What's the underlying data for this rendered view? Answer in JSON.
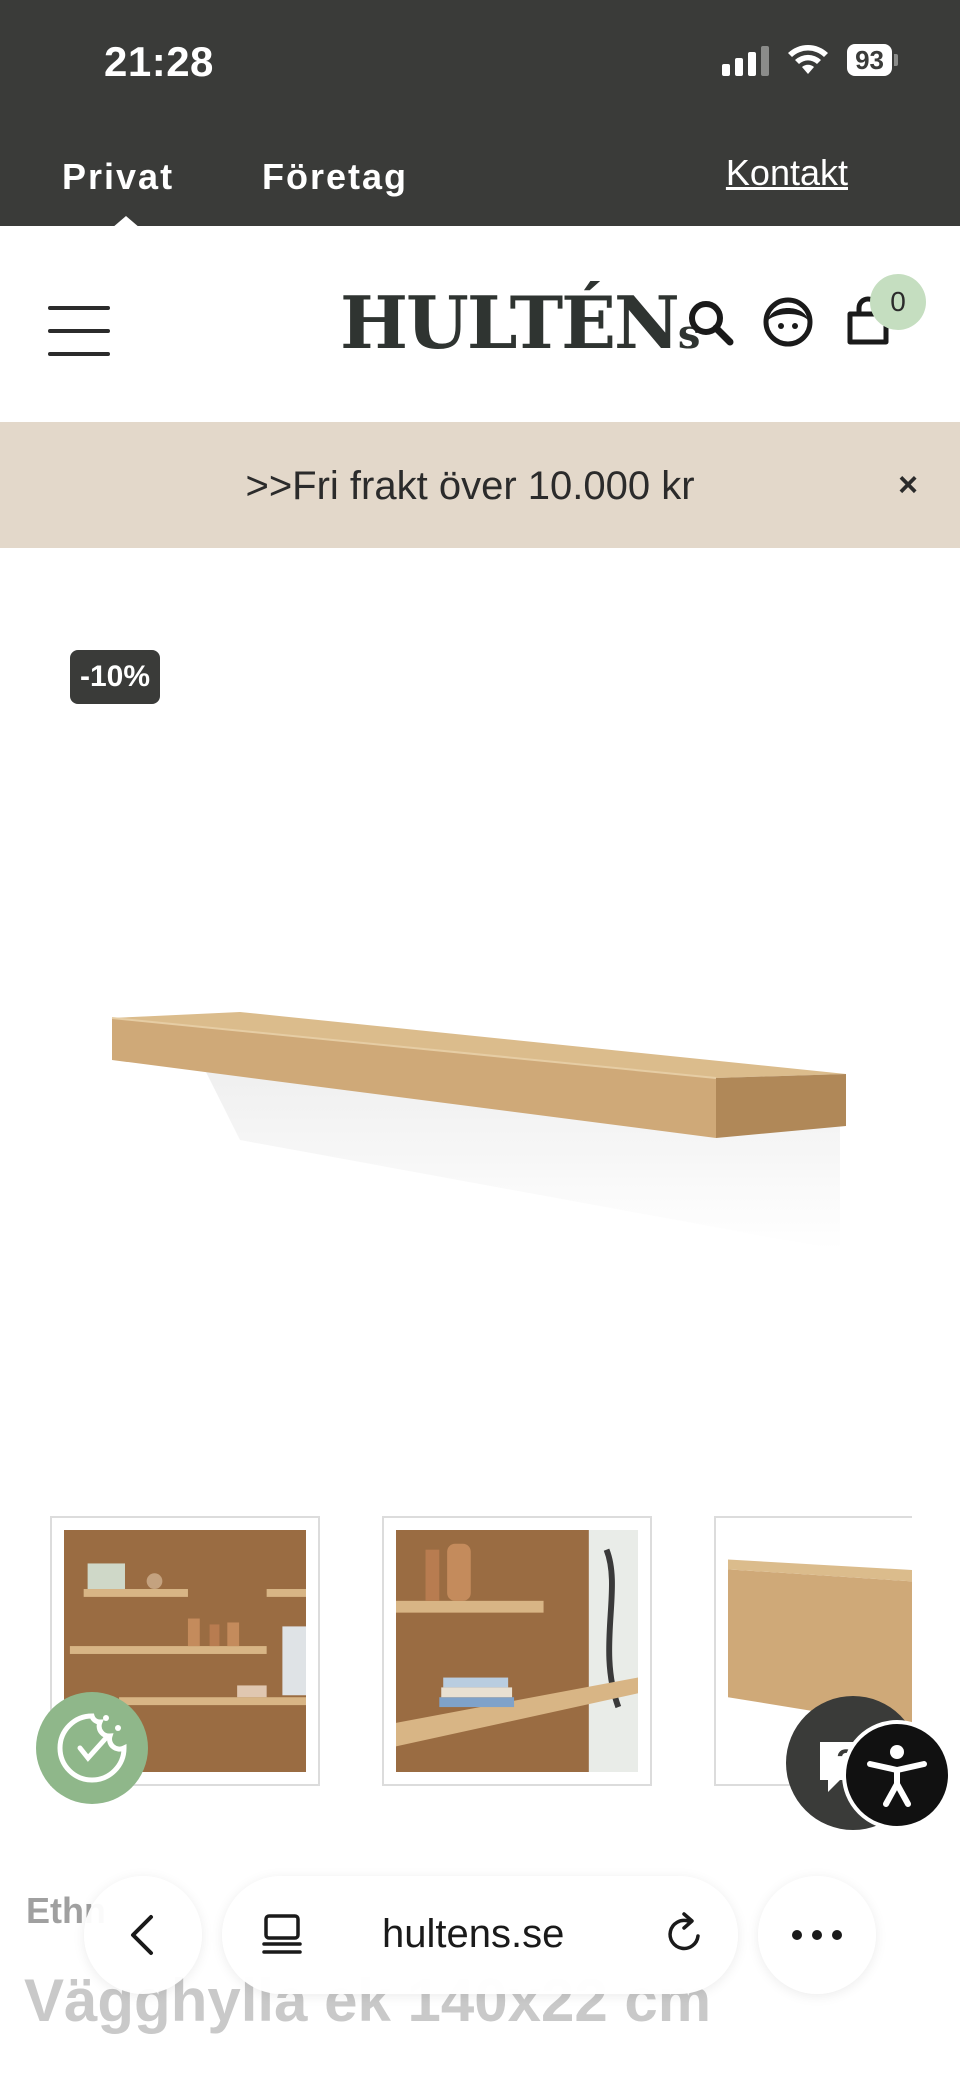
{
  "status_bar": {
    "time": "21:28",
    "battery": "93"
  },
  "top_nav": {
    "privat": "Privat",
    "foretag": "Företag",
    "kontakt": "Kontakt"
  },
  "header": {
    "logo_main": "HULTÉN",
    "logo_suffix": "s",
    "cart_count": "0"
  },
  "promo": {
    "text": ">>Fri frakt över 10.000 kr",
    "close": "×"
  },
  "product": {
    "discount_badge": "-10%",
    "brand": "Ethn",
    "title": "Vägghylla ek 140x22 cm"
  },
  "chat": {
    "label": "?"
  },
  "browser": {
    "url": "hultens.se"
  },
  "colors": {
    "dark": "#3a3b39",
    "promo_bg": "#e3d8ca",
    "cart_badge": "#c5dec0",
    "cookie_btn": "#8fb78a",
    "oak": "#cfa978"
  },
  "icons": [
    "menu-icon",
    "search-icon",
    "user-icon",
    "cart-icon",
    "close-icon",
    "cookie-icon",
    "chat-icon",
    "accessibility-icon",
    "back-icon",
    "tabs-icon",
    "reload-icon",
    "more-icon"
  ]
}
